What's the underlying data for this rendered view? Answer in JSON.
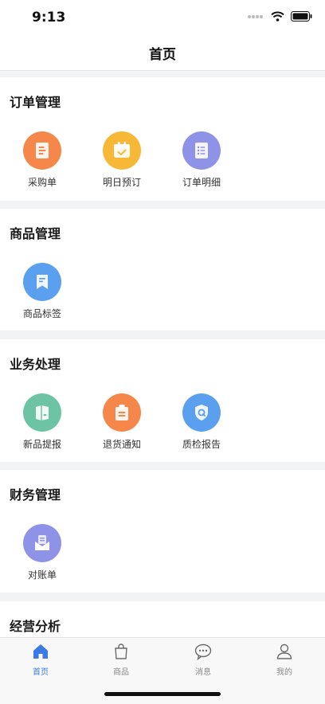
{
  "status": {
    "time": "9:13"
  },
  "nav": {
    "title": "首页"
  },
  "sections": [
    {
      "title": "订单管理",
      "items": [
        {
          "label": "采购单",
          "icon": "document-icon",
          "color": "#f5874a"
        },
        {
          "label": "明日预订",
          "icon": "calendar-check-icon",
          "color": "#f6b836"
        },
        {
          "label": "订单明细",
          "icon": "list-icon",
          "color": "#8f93e8"
        }
      ]
    },
    {
      "title": "商品管理",
      "items": [
        {
          "label": "商品标签",
          "icon": "tag-icon",
          "color": "#5aa0ef"
        }
      ]
    },
    {
      "title": "业务处理",
      "items": [
        {
          "label": "新品提报",
          "icon": "new-product-icon",
          "color": "#6dc4a5"
        },
        {
          "label": "退货通知",
          "icon": "clipboard-icon",
          "color": "#f5874a"
        },
        {
          "label": "质检报告",
          "icon": "shield-icon",
          "color": "#5aa0ef"
        }
      ]
    },
    {
      "title": "财务管理",
      "items": [
        {
          "label": "对账单",
          "icon": "envelope-icon",
          "color": "#8f93e8"
        }
      ]
    },
    {
      "title": "经营分析",
      "items": []
    }
  ],
  "tabs": [
    {
      "label": "首页",
      "icon": "home-icon",
      "active": true
    },
    {
      "label": "商品",
      "icon": "bag-icon",
      "active": false
    },
    {
      "label": "消息",
      "icon": "chat-icon",
      "active": false
    },
    {
      "label": "我的",
      "icon": "user-icon",
      "active": false
    }
  ],
  "colors": {
    "accent": "#3a79e8"
  }
}
